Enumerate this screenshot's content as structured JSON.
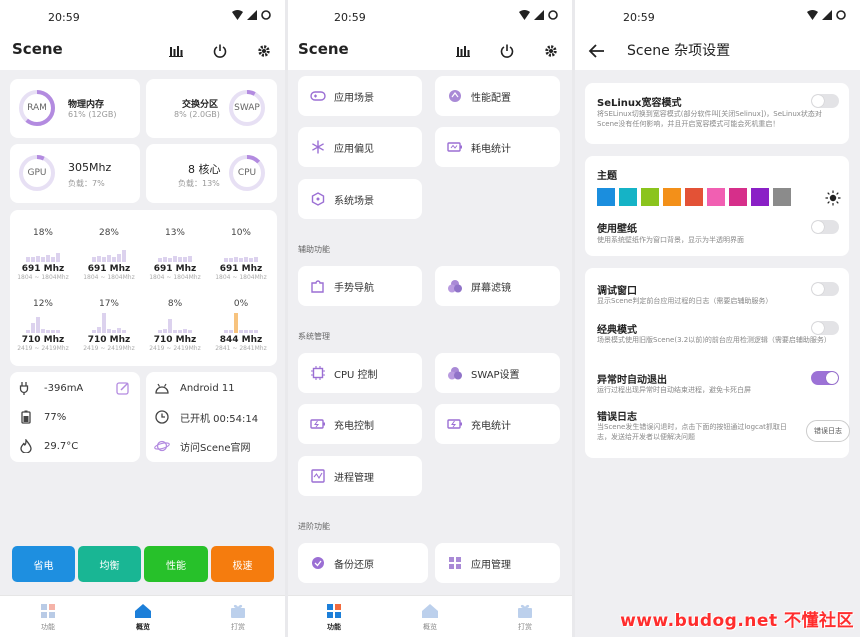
{
  "status": {
    "time": "20:59"
  },
  "screen1": {
    "title": "Scene",
    "ram": {
      "ring_label": "RAM",
      "title": "物理内存",
      "sub": "61% (12GB)",
      "percent": 61
    },
    "swap": {
      "ring_label": "SWAP",
      "title": "交换分区",
      "sub": "8% (2.0GB)",
      "percent": 8
    },
    "gpu": {
      "ring_label": "GPU",
      "freq": "305Mhz",
      "load": "负载：7%",
      "percent": 7
    },
    "cpu": {
      "ring_label": "CPU",
      "cores": "8 核心",
      "load": "负载：13%",
      "percent": 13
    },
    "cores": [
      {
        "pct": "18%",
        "freq": "691 Mhz",
        "range": "1804 ~ 1804Mhz"
      },
      {
        "pct": "28%",
        "freq": "691 Mhz",
        "range": "1804 ~ 1804Mhz"
      },
      {
        "pct": "13%",
        "freq": "691 Mhz",
        "range": "1804 ~ 1804Mhz"
      },
      {
        "pct": "10%",
        "freq": "691 Mhz",
        "range": "1804 ~ 1804Mhz"
      },
      {
        "pct": "12%",
        "freq": "710 Mhz",
        "range": "2419 ~ 2419Mhz"
      },
      {
        "pct": "17%",
        "freq": "710 Mhz",
        "range": "2419 ~ 2419Mhz"
      },
      {
        "pct": "8%",
        "freq": "710 Mhz",
        "range": "2419 ~ 2419Mhz"
      },
      {
        "pct": "0%",
        "freq": "844 Mhz",
        "range": "2841 ~ 2841Mhz"
      }
    ],
    "battery": {
      "current": "-396mA",
      "level": "77%",
      "temp": "29.7°C"
    },
    "device": {
      "android": "Android 11",
      "uptime": "已开机  00:54:14",
      "visit": "访问Scene官网"
    },
    "modes": [
      {
        "label": "省电",
        "color": "#1e8fe0"
      },
      {
        "label": "均衡",
        "color": "#19b694"
      },
      {
        "label": "性能",
        "color": "#27c12a"
      },
      {
        "label": "极速",
        "color": "#f57c0e"
      }
    ],
    "nav": [
      "功能",
      "概览",
      "打赏"
    ]
  },
  "screen2": {
    "title": "Scene",
    "tiles": {
      "app_scene": "应用场景",
      "perf_config": "性能配置",
      "app_pref": "应用偏见",
      "power_stats": "耗电统计",
      "sys_scene": "系统场景",
      "gesture": "手势导航",
      "screen_filter": "屏幕滤镜",
      "cpu_control": "CPU 控制",
      "swap_settings": "SWAP设置",
      "charge_control": "充电控制",
      "charge_stats": "充电统计",
      "process_mgmt": "进程管理",
      "backup_restore": "备份还原",
      "app_mgmt": "应用管理"
    },
    "sections": {
      "assist": "辅助功能",
      "system": "系统管理",
      "advanced": "进阶功能"
    },
    "nav": [
      "功能",
      "概览",
      "打赏"
    ]
  },
  "screen3": {
    "title": "Scene 杂项设置",
    "selinux": {
      "title": "SeLinux宽容模式",
      "desc": "将SELinux切换到宽容模式(部分软件叫[关闭Selinux])，SeLinux状态对Scene没有任何影响，并且开启宽容模式可能会死机重启！"
    },
    "theme": {
      "title": "主题",
      "colors": [
        "#1b8ede",
        "#15b3c6",
        "#8bc41d",
        "#f39019",
        "#e35236",
        "#f15fb2",
        "#d62f8a",
        "#8a20c6",
        "#8b8b8b"
      ]
    },
    "wallpaper": {
      "title": "使用壁纸",
      "desc": "使用系统壁纸作为窗口背景，显示为半透明界面"
    },
    "debug": {
      "title": "调试窗口",
      "desc": "显示Scene判定前台应用过程的日志（需要启辅助服务）"
    },
    "classic": {
      "title": "经典模式",
      "desc": "场景模式使用旧版Scene(3.2以前)的前台应用检测逻辑（需要启辅助服务）"
    },
    "autoexit": {
      "title": "异常时自动退出",
      "desc": "运行过程出现异常时自动结束进程，避免卡死白屏"
    },
    "errlog": {
      "title": "错误日志",
      "desc": "当Scene发生错误闪退时，点击下面的按钮通过logcat抓取日志，发送给开发者以便解决问题",
      "button": "错误日志"
    }
  },
  "watermark": "www.budog.net 不懂社区"
}
